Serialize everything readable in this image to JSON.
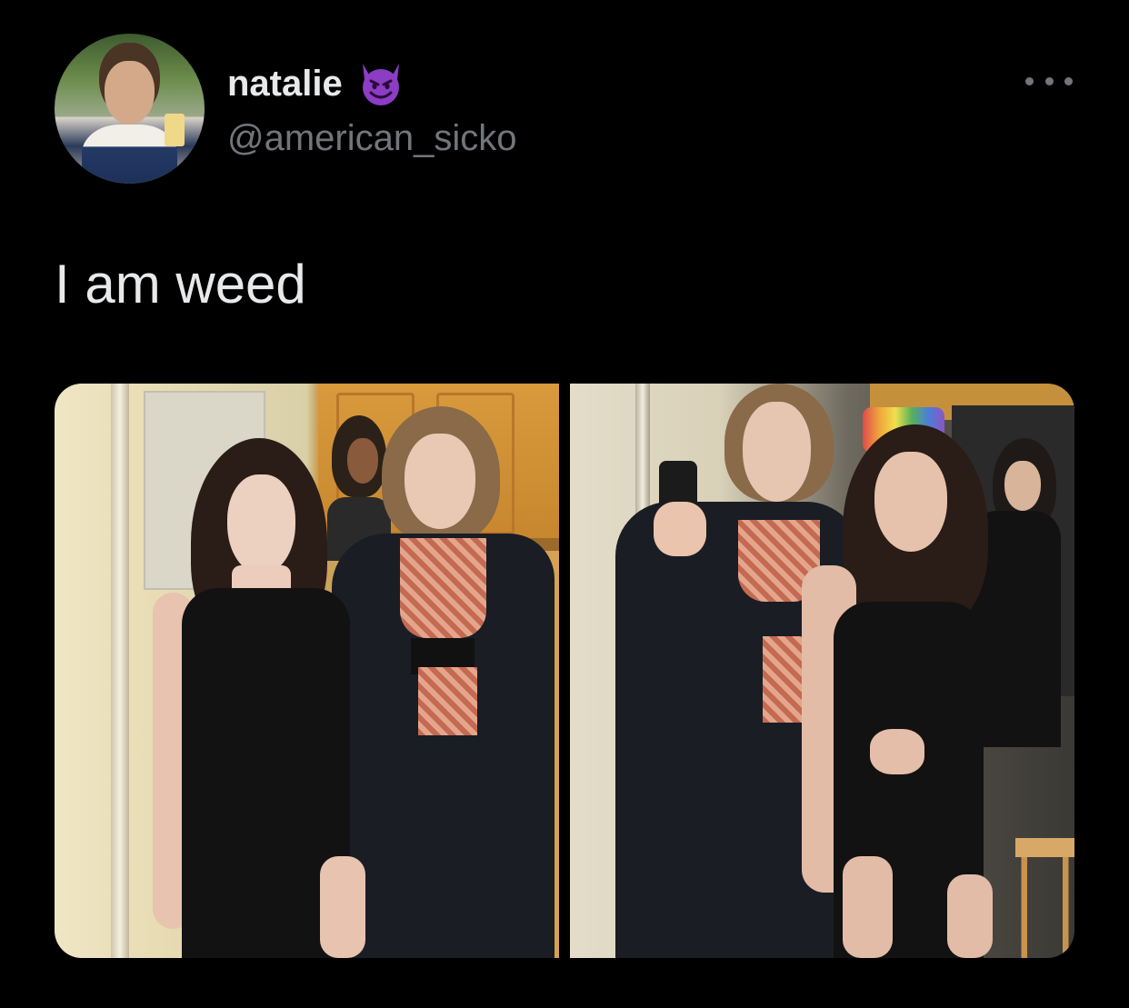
{
  "tweet": {
    "display_name": "natalie",
    "name_emoji": "smiling-face-with-horns-icon",
    "handle": "@american_sicko",
    "text": "I am weed",
    "media_count": 2
  },
  "colors": {
    "background": "#000000",
    "primary_text": "#e7e9ea",
    "secondary_text": "#71767b",
    "emoji_purple": "#8c3dc4"
  }
}
